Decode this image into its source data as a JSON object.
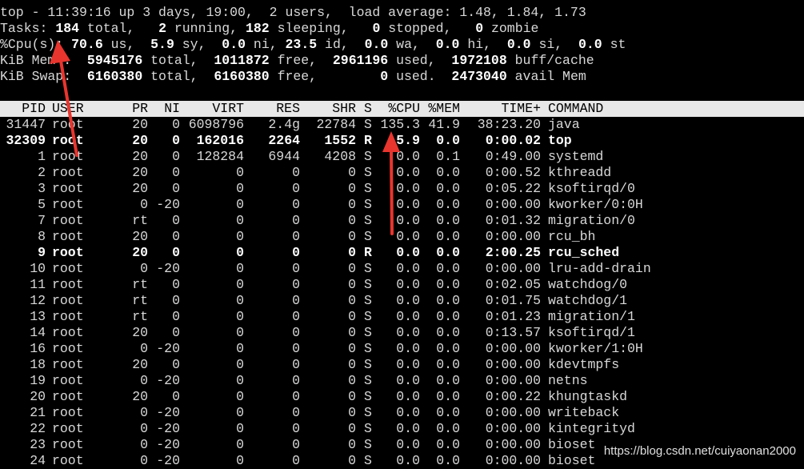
{
  "summary": {
    "uptime_line": "top - 11:39:16 up 3 days, 19:00,  2 users,  load average: 1.48, 1.84, 1.73",
    "tasks": [
      {
        "t": "Tasks: "
      },
      {
        "t": "184",
        "b": true
      },
      {
        "t": " total,   "
      },
      {
        "t": "2",
        "b": true
      },
      {
        "t": " running, "
      },
      {
        "t": "182",
        "b": true
      },
      {
        "t": " sleeping,   "
      },
      {
        "t": "0",
        "b": true
      },
      {
        "t": " stopped,   "
      },
      {
        "t": "0",
        "b": true
      },
      {
        "t": " zombie"
      }
    ],
    "cpu": [
      {
        "t": "%Cpu(s): "
      },
      {
        "t": "70.6",
        "b": true
      },
      {
        "t": " us,  "
      },
      {
        "t": "5.9",
        "b": true
      },
      {
        "t": " sy,  "
      },
      {
        "t": "0.0",
        "b": true
      },
      {
        "t": " ni, "
      },
      {
        "t": "23.5",
        "b": true
      },
      {
        "t": " id,  "
      },
      {
        "t": "0.0",
        "b": true
      },
      {
        "t": " wa,  "
      },
      {
        "t": "0.0",
        "b": true
      },
      {
        "t": " hi,  "
      },
      {
        "t": "0.0",
        "b": true
      },
      {
        "t": " si,  "
      },
      {
        "t": "0.0",
        "b": true
      },
      {
        "t": " st"
      }
    ],
    "mem": [
      {
        "t": "KiB Mem :  "
      },
      {
        "t": "5945176",
        "b": true
      },
      {
        "t": " total,  "
      },
      {
        "t": "1011872",
        "b": true
      },
      {
        "t": " free,  "
      },
      {
        "t": "2961196",
        "b": true
      },
      {
        "t": " used,  "
      },
      {
        "t": "1972108",
        "b": true
      },
      {
        "t": " buff/cache"
      }
    ],
    "swap": [
      {
        "t": "KiB Swap:  "
      },
      {
        "t": "6160380",
        "b": true
      },
      {
        "t": " total,  "
      },
      {
        "t": "6160380",
        "b": true
      },
      {
        "t": " free,        "
      },
      {
        "t": "0",
        "b": true
      },
      {
        "t": " used.  "
      },
      {
        "t": "2473040",
        "b": true
      },
      {
        "t": " avail Mem"
      }
    ]
  },
  "columns": [
    "PID",
    "USER",
    "PR",
    "NI",
    "VIRT",
    "RES",
    "SHR",
    "S",
    "%CPU",
    "%MEM",
    "TIME+",
    "COMMAND"
  ],
  "processes": [
    {
      "pid": "31447",
      "user": "root",
      "pr": "20",
      "ni": "0",
      "virt": "6098796",
      "res": "2.4g",
      "shr": "22784",
      "s": "S",
      "cpu": "135.3",
      "mem": "41.9",
      "time": "38:23.20",
      "cmd": "java",
      "bold": false
    },
    {
      "pid": "32309",
      "user": "root",
      "pr": "20",
      "ni": "0",
      "virt": "162016",
      "res": "2264",
      "shr": "1552",
      "s": "R",
      "cpu": "5.9",
      "mem": "0.0",
      "time": "0:00.02",
      "cmd": "top",
      "bold": true
    },
    {
      "pid": "1",
      "user": "root",
      "pr": "20",
      "ni": "0",
      "virt": "128284",
      "res": "6944",
      "shr": "4208",
      "s": "S",
      "cpu": "0.0",
      "mem": "0.1",
      "time": "0:49.00",
      "cmd": "systemd",
      "bold": false
    },
    {
      "pid": "2",
      "user": "root",
      "pr": "20",
      "ni": "0",
      "virt": "0",
      "res": "0",
      "shr": "0",
      "s": "S",
      "cpu": "0.0",
      "mem": "0.0",
      "time": "0:00.52",
      "cmd": "kthreadd",
      "bold": false
    },
    {
      "pid": "3",
      "user": "root",
      "pr": "20",
      "ni": "0",
      "virt": "0",
      "res": "0",
      "shr": "0",
      "s": "S",
      "cpu": "0.0",
      "mem": "0.0",
      "time": "0:05.22",
      "cmd": "ksoftirqd/0",
      "bold": false
    },
    {
      "pid": "5",
      "user": "root",
      "pr": "0",
      "ni": "-20",
      "virt": "0",
      "res": "0",
      "shr": "0",
      "s": "S",
      "cpu": "0.0",
      "mem": "0.0",
      "time": "0:00.00",
      "cmd": "kworker/0:0H",
      "bold": false
    },
    {
      "pid": "7",
      "user": "root",
      "pr": "rt",
      "ni": "0",
      "virt": "0",
      "res": "0",
      "shr": "0",
      "s": "S",
      "cpu": "0.0",
      "mem": "0.0",
      "time": "0:01.32",
      "cmd": "migration/0",
      "bold": false
    },
    {
      "pid": "8",
      "user": "root",
      "pr": "20",
      "ni": "0",
      "virt": "0",
      "res": "0",
      "shr": "0",
      "s": "S",
      "cpu": "0.0",
      "mem": "0.0",
      "time": "0:00.00",
      "cmd": "rcu_bh",
      "bold": false
    },
    {
      "pid": "9",
      "user": "root",
      "pr": "20",
      "ni": "0",
      "virt": "0",
      "res": "0",
      "shr": "0",
      "s": "R",
      "cpu": "0.0",
      "mem": "0.0",
      "time": "2:00.25",
      "cmd": "rcu_sched",
      "bold": true
    },
    {
      "pid": "10",
      "user": "root",
      "pr": "0",
      "ni": "-20",
      "virt": "0",
      "res": "0",
      "shr": "0",
      "s": "S",
      "cpu": "0.0",
      "mem": "0.0",
      "time": "0:00.00",
      "cmd": "lru-add-drain",
      "bold": false
    },
    {
      "pid": "11",
      "user": "root",
      "pr": "rt",
      "ni": "0",
      "virt": "0",
      "res": "0",
      "shr": "0",
      "s": "S",
      "cpu": "0.0",
      "mem": "0.0",
      "time": "0:02.05",
      "cmd": "watchdog/0",
      "bold": false
    },
    {
      "pid": "12",
      "user": "root",
      "pr": "rt",
      "ni": "0",
      "virt": "0",
      "res": "0",
      "shr": "0",
      "s": "S",
      "cpu": "0.0",
      "mem": "0.0",
      "time": "0:01.75",
      "cmd": "watchdog/1",
      "bold": false
    },
    {
      "pid": "13",
      "user": "root",
      "pr": "rt",
      "ni": "0",
      "virt": "0",
      "res": "0",
      "shr": "0",
      "s": "S",
      "cpu": "0.0",
      "mem": "0.0",
      "time": "0:01.23",
      "cmd": "migration/1",
      "bold": false
    },
    {
      "pid": "14",
      "user": "root",
      "pr": "20",
      "ni": "0",
      "virt": "0",
      "res": "0",
      "shr": "0",
      "s": "S",
      "cpu": "0.0",
      "mem": "0.0",
      "time": "0:13.57",
      "cmd": "ksoftirqd/1",
      "bold": false
    },
    {
      "pid": "16",
      "user": "root",
      "pr": "0",
      "ni": "-20",
      "virt": "0",
      "res": "0",
      "shr": "0",
      "s": "S",
      "cpu": "0.0",
      "mem": "0.0",
      "time": "0:00.00",
      "cmd": "kworker/1:0H",
      "bold": false
    },
    {
      "pid": "18",
      "user": "root",
      "pr": "20",
      "ni": "0",
      "virt": "0",
      "res": "0",
      "shr": "0",
      "s": "S",
      "cpu": "0.0",
      "mem": "0.0",
      "time": "0:00.00",
      "cmd": "kdevtmpfs",
      "bold": false
    },
    {
      "pid": "19",
      "user": "root",
      "pr": "0",
      "ni": "-20",
      "virt": "0",
      "res": "0",
      "shr": "0",
      "s": "S",
      "cpu": "0.0",
      "mem": "0.0",
      "time": "0:00.00",
      "cmd": "netns",
      "bold": false
    },
    {
      "pid": "20",
      "user": "root",
      "pr": "20",
      "ni": "0",
      "virt": "0",
      "res": "0",
      "shr": "0",
      "s": "S",
      "cpu": "0.0",
      "mem": "0.0",
      "time": "0:00.22",
      "cmd": "khungtaskd",
      "bold": false
    },
    {
      "pid": "21",
      "user": "root",
      "pr": "0",
      "ni": "-20",
      "virt": "0",
      "res": "0",
      "shr": "0",
      "s": "S",
      "cpu": "0.0",
      "mem": "0.0",
      "time": "0:00.00",
      "cmd": "writeback",
      "bold": false
    },
    {
      "pid": "22",
      "user": "root",
      "pr": "0",
      "ni": "-20",
      "virt": "0",
      "res": "0",
      "shr": "0",
      "s": "S",
      "cpu": "0.0",
      "mem": "0.0",
      "time": "0:00.00",
      "cmd": "kintegrityd",
      "bold": false
    },
    {
      "pid": "23",
      "user": "root",
      "pr": "0",
      "ni": "-20",
      "virt": "0",
      "res": "0",
      "shr": "0",
      "s": "S",
      "cpu": "0.0",
      "mem": "0.0",
      "time": "0:00.00",
      "cmd": "bioset",
      "bold": false
    },
    {
      "pid": "24",
      "user": "root",
      "pr": "0",
      "ni": "-20",
      "virt": "0",
      "res": "0",
      "shr": "0",
      "s": "S",
      "cpu": "0.0",
      "mem": "0.0",
      "time": "0:00.00",
      "cmd": "bioset",
      "bold": false
    }
  ],
  "watermark": "https://blog.csdn.net/cuiyaonan2000",
  "colors": {
    "background": "#000000",
    "text": "#d8d8d8",
    "header_bg": "#e8e8e8",
    "arrow": "#e8352e"
  }
}
